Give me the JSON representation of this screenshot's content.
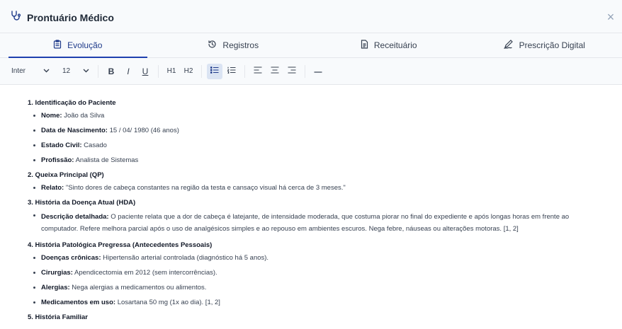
{
  "header": {
    "title": "Prontuário Médico",
    "close": "×"
  },
  "tabs": [
    {
      "label": "Evolução",
      "icon": "clipboard-icon",
      "active": true
    },
    {
      "label": "Registros",
      "icon": "history-icon",
      "active": false
    },
    {
      "label": "Receituário",
      "icon": "document-icon",
      "active": false
    },
    {
      "label": "Prescrição Digital",
      "icon": "signature-icon",
      "active": false
    }
  ],
  "toolbar": {
    "font": "Inter",
    "size": "12",
    "bold": "B",
    "italic": "I",
    "underline": "U",
    "h1": "H1",
    "h2": "H2"
  },
  "doc": {
    "s1": {
      "title": "1. Identificação do Paciente",
      "items": [
        {
          "label": "Nome:",
          "value": " João da Silva"
        },
        {
          "label": "Data de Nascimento:",
          "value": " 15 / 04/ 1980 (46 anos)"
        },
        {
          "label": "Estado Civil:",
          "value": " Casado"
        },
        {
          "label": "Profissão:",
          "value": " Analista de Sistemas"
        }
      ]
    },
    "s2": {
      "title": "2. Queixa Principal (QP)",
      "items": [
        {
          "label": "Relato:",
          "value": " \"Sinto dores de cabeça constantes na região da testa e cansaço visual há cerca de 3 meses.\""
        }
      ]
    },
    "s3": {
      "title": "3. História da Doença Atual (HDA)",
      "items": [
        {
          "label": "Descrição detalhada:",
          "value": " O paciente relata que a dor de cabeça é latejante, de intensidade moderada, que costuma piorar no final do expediente e após longas horas em frente ao computador. Refere melhora parcial após o uso de analgésicos simples e ao repouso em ambientes escuros. Nega febre, náuseas ou alterações motoras. [1, 2]"
        }
      ]
    },
    "s4": {
      "title": "4. História Patológica Pregressa (Antecedentes Pessoais)",
      "items": [
        {
          "label": "Doenças crônicas:",
          "value": " Hipertensão arterial controlada (diagnóstico há 5 anos)."
        },
        {
          "label": "Cirurgias:",
          "value": " Apendicectomia em 2012 (sem intercorrências)."
        },
        {
          "label": "Alergias:",
          "value": " Nega alergias a medicamentos ou alimentos."
        },
        {
          "label": "Medicamentos em uso:",
          "value": " Losartana 50 mg (1x ao dia). [1, 2]"
        }
      ]
    },
    "s5": {
      "title": "5. História Familiar"
    }
  }
}
